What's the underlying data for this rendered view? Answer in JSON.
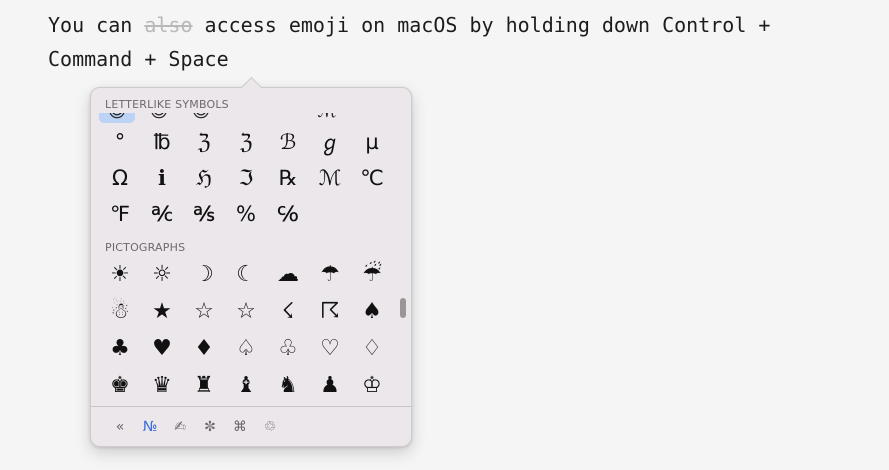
{
  "document": {
    "line1_before": "You can ",
    "line1_strike": "also",
    "line1_after": " access emoji on macOS by holding down Control +",
    "line2": "Command + Space"
  },
  "picker": {
    "peek_glyphs": [
      "☺",
      "☺",
      "☺",
      "ℳ"
    ],
    "sections": [
      {
        "header": "LETTERLIKE SYMBOLS",
        "rows": [
          [
            "°",
            "℔",
            "ℨ",
            "ℨ",
            "ℬ",
            "ℊ",
            "µ"
          ],
          [
            "Ω",
            "ℹ",
            "ℌ",
            "ℑ",
            "℞",
            "ℳ",
            "℃"
          ],
          [
            "℉",
            "℀",
            "℁",
            "%",
            "℅"
          ]
        ]
      },
      {
        "header": "PICTOGRAPHS",
        "rows": [
          [
            "☀",
            "☼",
            "☽",
            "☾",
            "☁",
            "☂",
            "☔"
          ],
          [
            "☃",
            "★",
            "☆",
            "☆",
            "☇",
            "☈",
            "♠"
          ],
          [
            "♣",
            "♥",
            "♦",
            "♤",
            "♧",
            "♡",
            "♢"
          ],
          [
            "♚",
            "♛",
            "♜",
            "♝",
            "♞",
            "♟",
            "♔"
          ]
        ]
      }
    ],
    "footer_tabs": [
      {
        "label": "«",
        "name": "recent-back-tab",
        "active": false
      },
      {
        "label": "№",
        "name": "letterlike-tab",
        "active": true
      },
      {
        "label": "✍",
        "name": "pictographs-tab",
        "active": false
      },
      {
        "label": "✼",
        "name": "bullets-stars-tab",
        "active": false
      },
      {
        "label": "⌘",
        "name": "technical-symbols-tab",
        "active": false
      },
      {
        "label": "♲",
        "name": "signs-tab",
        "active": false
      }
    ]
  }
}
